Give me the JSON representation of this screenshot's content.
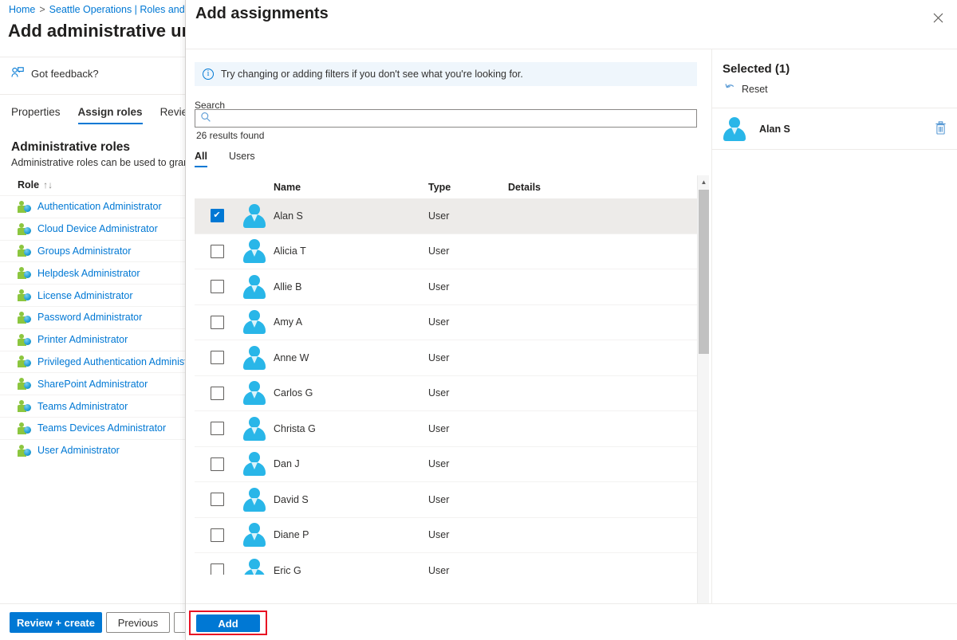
{
  "background_page": {
    "breadcrumb": {
      "home": "Home",
      "separator": ">",
      "current": "Seattle Operations | Roles and"
    },
    "title": "Add administrative uni",
    "feedback": {
      "label": "Got feedback?",
      "icon": "feedback-icon"
    },
    "tabs": [
      {
        "label": "Properties",
        "active": false
      },
      {
        "label": "Assign roles",
        "active": true
      },
      {
        "label": "Review",
        "active": false
      }
    ],
    "section": {
      "title": "Administrative roles",
      "subtitle": "Administrative roles can be used to grant"
    },
    "roles_column_header": "Role",
    "roles_sort_glyph": "↑↓",
    "roles": [
      "Authentication Administrator",
      "Cloud Device Administrator",
      "Groups Administrator",
      "Helpdesk Administrator",
      "License Administrator",
      "Password Administrator",
      "Printer Administrator",
      "Privileged Authentication Administ",
      "SharePoint Administrator",
      "Teams Administrator",
      "Teams Devices Administrator",
      "User Administrator"
    ],
    "footer": {
      "review_create": "Review + create",
      "previous": "Previous",
      "next_partial": ""
    }
  },
  "dialog": {
    "title": "Add assignments",
    "close_icon": "close-icon",
    "info_bar": {
      "icon": "info-icon",
      "message": "Try changing or adding filters if you don't see what you're looking for."
    },
    "search": {
      "label": "Search",
      "value": "",
      "placeholder": "",
      "icon": "search-icon"
    },
    "results_count": "26 results found",
    "filter_tabs": [
      {
        "label": "All",
        "active": true
      },
      {
        "label": "Users",
        "active": false
      }
    ],
    "table": {
      "columns": [
        "Name",
        "Type",
        "Details"
      ],
      "checkbox_check_glyph": "✔",
      "rows": [
        {
          "name": "Alan S",
          "type": "User",
          "details": "",
          "checked": true
        },
        {
          "name": "Alicia T",
          "type": "User",
          "details": "",
          "checked": false
        },
        {
          "name": "Allie B",
          "type": "User",
          "details": "",
          "checked": false
        },
        {
          "name": "Amy A",
          "type": "User",
          "details": "",
          "checked": false
        },
        {
          "name": "Anne W",
          "type": "User",
          "details": "",
          "checked": false
        },
        {
          "name": "Carlos G",
          "type": "User",
          "details": "",
          "checked": false
        },
        {
          "name": "Christa G",
          "type": "User",
          "details": "",
          "checked": false
        },
        {
          "name": "Dan J",
          "type": "User",
          "details": "",
          "checked": false
        },
        {
          "name": "David S",
          "type": "User",
          "details": "",
          "checked": false
        },
        {
          "name": "Diane P",
          "type": "User",
          "details": "",
          "checked": false
        },
        {
          "name": "Eric G",
          "type": "User",
          "details": "",
          "checked": false
        }
      ]
    },
    "scrollbars": {
      "vertical_up": "▲",
      "vertical_down": "▼",
      "horizontal_left": "◀",
      "horizontal_right": "▶"
    },
    "selected_panel": {
      "title": "Selected (1)",
      "reset_label": "Reset",
      "reset_icon": "undo-icon",
      "items": [
        {
          "name": "Alan S",
          "delete_icon": "trash-icon"
        }
      ]
    },
    "footer": {
      "add_label": "Add"
    }
  },
  "colors": {
    "accent": "#0078d4",
    "info_bg": "#eff6fc",
    "selected_row_bg": "#edebe9",
    "highlight_outline": "#e81123",
    "avatar_blue": "#29b6e8",
    "role_green": "#8cc63f"
  }
}
